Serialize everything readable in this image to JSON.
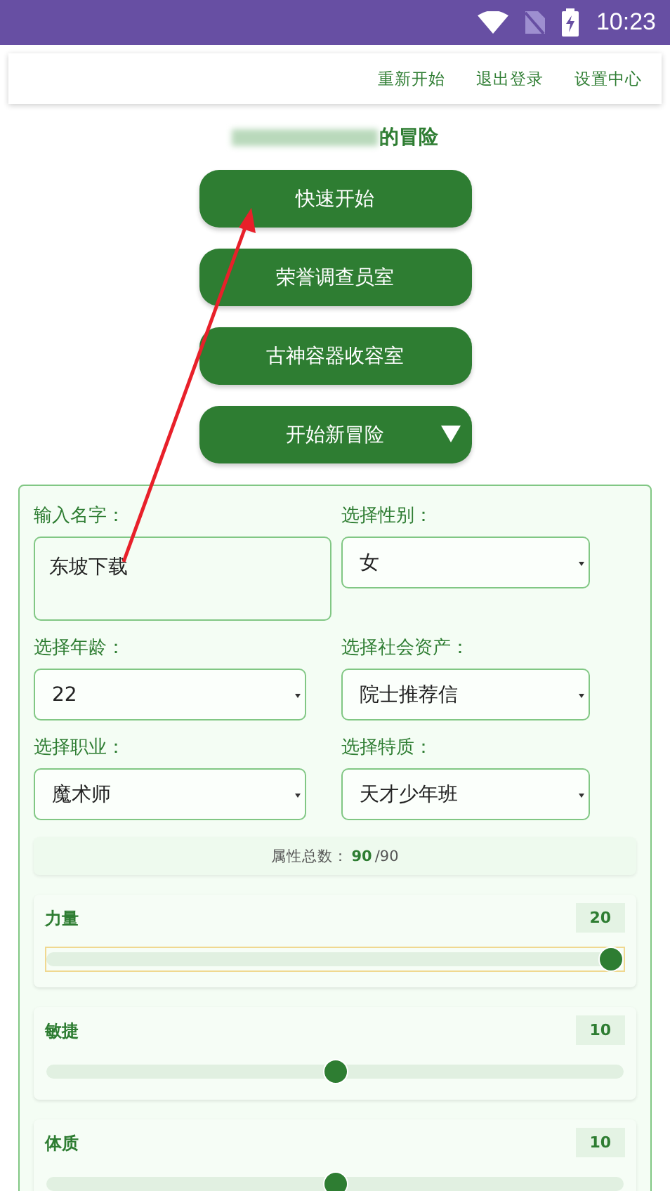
{
  "status_bar": {
    "time": "10:23"
  },
  "nav": [
    {
      "label": "重新开始"
    },
    {
      "label": "退出登录"
    },
    {
      "label": "设置中心"
    }
  ],
  "title": {
    "suffix": "的冒险"
  },
  "menu_buttons": [
    {
      "label": "快速开始",
      "kind": "plain"
    },
    {
      "label": "荣誉调查员室",
      "kind": "plain"
    },
    {
      "label": "古神容器收容室",
      "kind": "plain"
    },
    {
      "label": "开始新冒险",
      "kind": "dropdown",
      "expanded": false
    }
  ],
  "form": {
    "fields": [
      {
        "label": "输入名字：",
        "kind": "text",
        "value": "东坡下载"
      },
      {
        "label": "选择性别：",
        "kind": "select",
        "value": "女"
      },
      {
        "label": "选择年龄：",
        "kind": "select",
        "value": "22"
      },
      {
        "label": "选择社会资产：",
        "kind": "select",
        "value": "院士推荐信"
      },
      {
        "label": "选择职业：",
        "kind": "select",
        "value": "魔术师"
      },
      {
        "label": "选择特质：",
        "kind": "select",
        "value": "天才少年班"
      }
    ],
    "attribute_total": {
      "label": "属性总数：",
      "value": "90",
      "max": "/90"
    },
    "attributes": [
      {
        "name": "力量",
        "value": "20",
        "level": 1,
        "focused": true
      },
      {
        "name": "敏捷",
        "value": "10",
        "level": 0.5,
        "focused": false
      },
      {
        "name": "体质",
        "value": "10",
        "level": 0.5,
        "focused": false
      }
    ]
  }
}
